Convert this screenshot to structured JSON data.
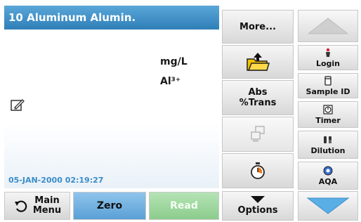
{
  "header": {
    "title": "10 Aluminum Alumin."
  },
  "reading": {
    "unit": "mg/L",
    "species": "Al³⁺"
  },
  "status": {
    "datetime": "05-JAN-2000  02:19:27"
  },
  "bottom": {
    "main_menu_line1": "Main",
    "main_menu_line2": "Menu",
    "zero": "Zero",
    "read": "Read"
  },
  "middle": {
    "more": "More...",
    "abs_line1": "Abs",
    "abs_line2": "%Trans",
    "options": "Options"
  },
  "right": {
    "login": "Login",
    "sample_id": "Sample ID",
    "timer": "Timer",
    "dilution": "Dilution",
    "aqa": "AQA"
  },
  "colors": {
    "title_bar": "#2f7fb8",
    "zero_button": "#5aa0d6",
    "read_button": "#8ccc8c",
    "datetime": "#3a8cc8"
  }
}
